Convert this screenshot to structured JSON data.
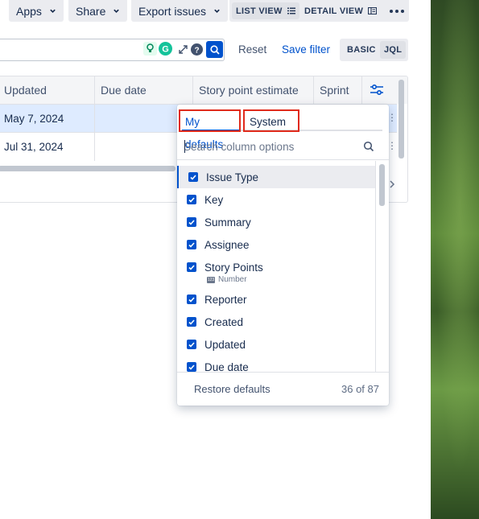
{
  "toolbar": {
    "apps_label": "Apps",
    "share_label": "Share",
    "export_label": "Export issues",
    "list_view_label": "LIST VIEW",
    "detail_view_label": "DETAIL VIEW"
  },
  "search_row": {
    "reset_label": "Reset",
    "save_filter_label": "Save filter",
    "basic_label": "BASIC",
    "jql_label": "JQL"
  },
  "table": {
    "columns": [
      "Updated",
      "Due date",
      "Story point estimate",
      "Sprint"
    ],
    "rows": [
      {
        "updated": "May 7, 2024",
        "due_date": "",
        "story_points": "",
        "sprint": ""
      },
      {
        "updated": "Jul 31, 2024",
        "due_date": "",
        "story_points": "",
        "sprint": ""
      }
    ]
  },
  "column_popup": {
    "tabs": [
      "My defaults",
      "System"
    ],
    "search_placeholder": "Search column options",
    "items": [
      {
        "label": "Issue Type",
        "checked": true
      },
      {
        "label": "Key",
        "checked": true
      },
      {
        "label": "Summary",
        "checked": true
      },
      {
        "label": "Assignee",
        "checked": true
      },
      {
        "label": "Story Points",
        "checked": true,
        "sublabel": "Number"
      },
      {
        "label": "Reporter",
        "checked": true
      },
      {
        "label": "Created",
        "checked": true
      },
      {
        "label": "Updated",
        "checked": true
      },
      {
        "label": "Due date",
        "checked": true
      }
    ],
    "restore_label": "Restore defaults",
    "count_label": "36 of 87"
  },
  "colors": {
    "accent": "#0052cc",
    "highlight_border": "#e02a1b",
    "selected_row": "#deebff"
  }
}
